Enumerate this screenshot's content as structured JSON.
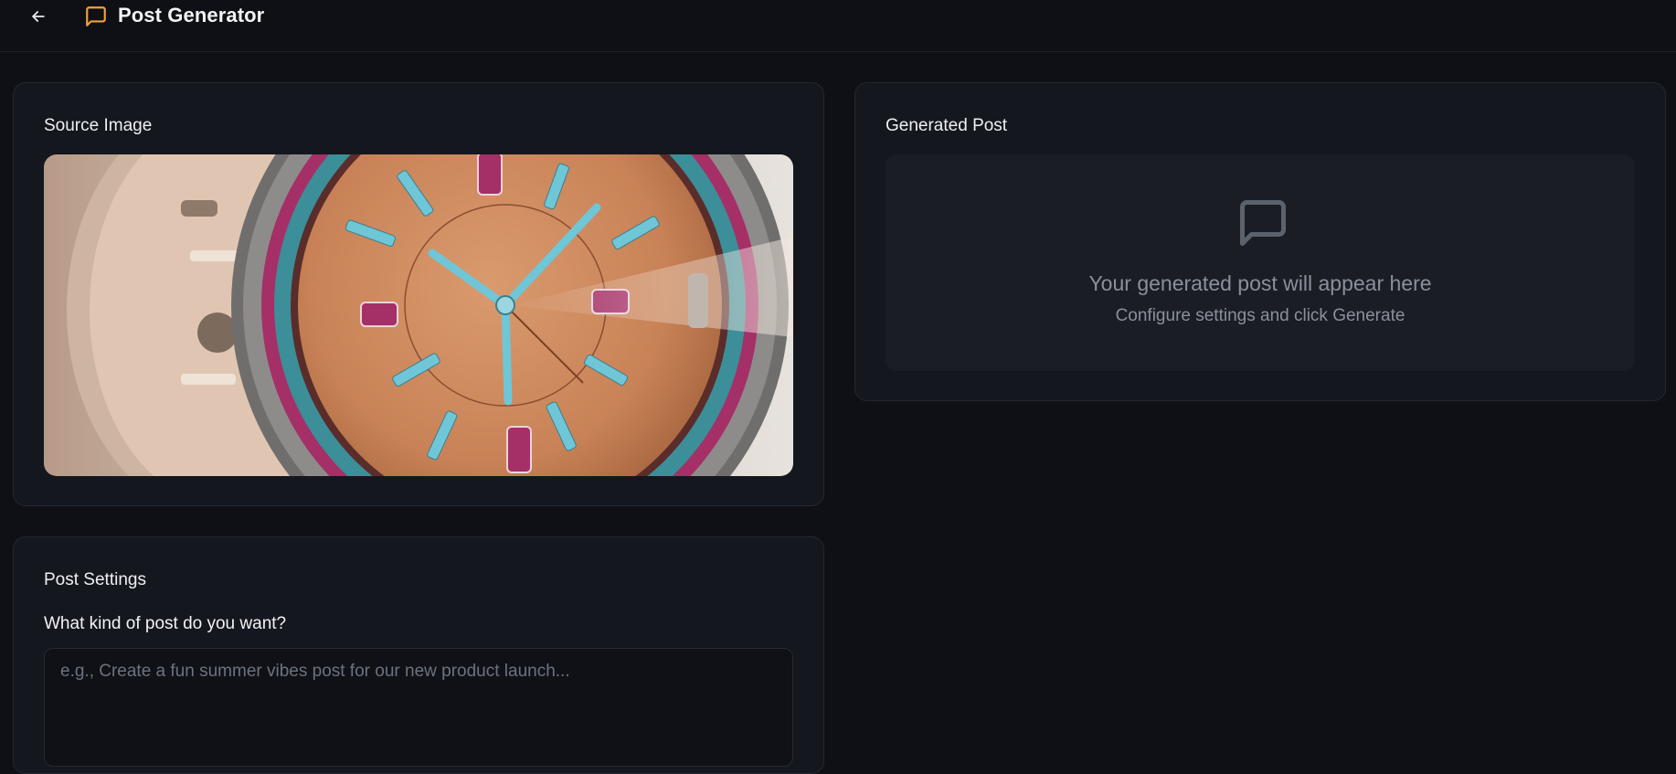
{
  "header": {
    "title": "Post Generator",
    "back_icon": "arrow-left-icon",
    "title_icon": "message-square-icon",
    "accent_color": "#f0a13a"
  },
  "source": {
    "title": "Source Image",
    "image_alt": "watch-photo"
  },
  "generated": {
    "title": "Generated Post",
    "empty_icon": "message-square-icon",
    "empty_title": "Your generated post will appear here",
    "empty_subtitle": "Configure settings and click Generate"
  },
  "settings": {
    "title": "Post Settings",
    "prompt_label": "What kind of post do you want?",
    "prompt_placeholder": "e.g., Create a fun summer vibes post for our new product launch...",
    "prompt_value": ""
  }
}
